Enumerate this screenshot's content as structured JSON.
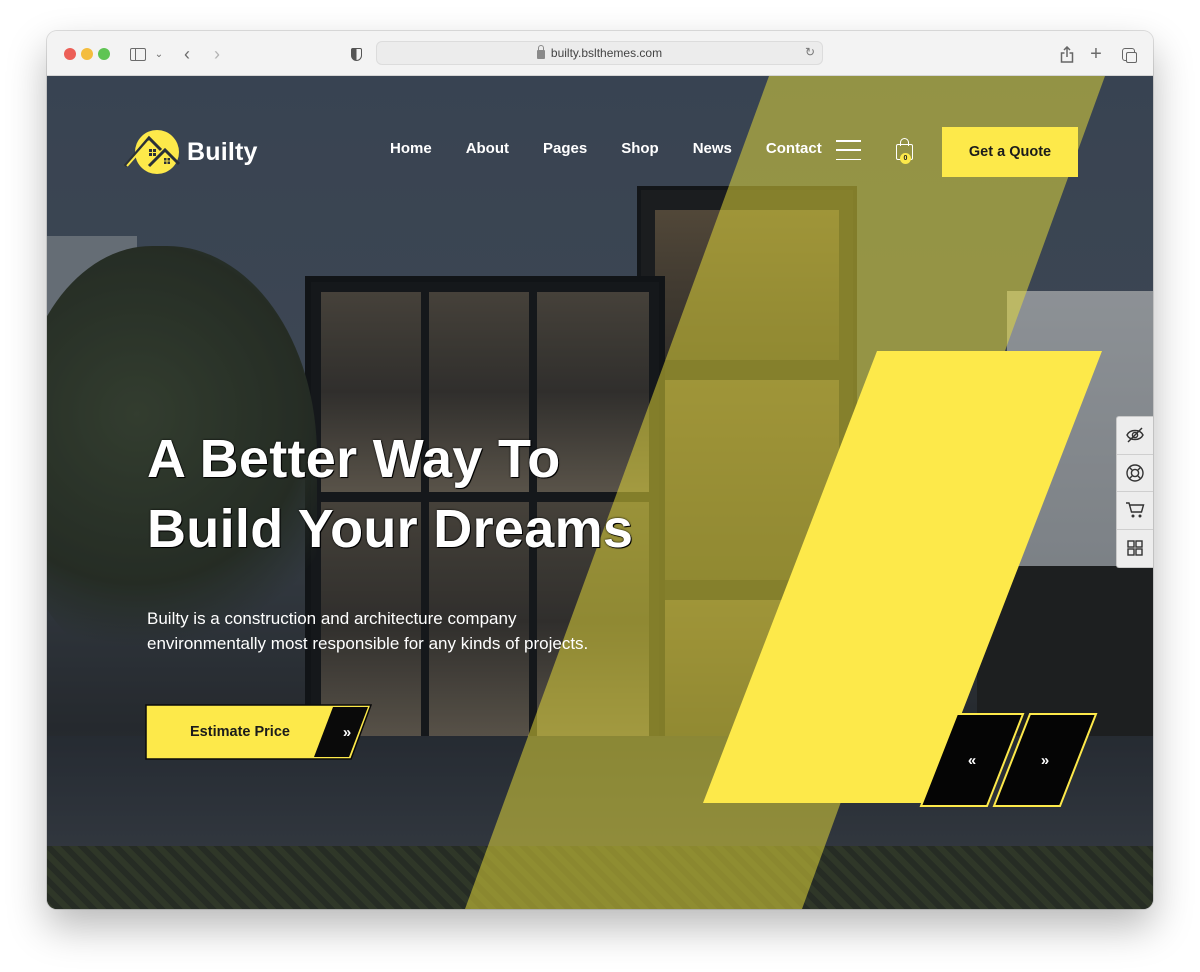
{
  "browser": {
    "url": "builty.bslthemes.com",
    "icons": [
      "sidebar-toggle-icon",
      "chevron-down-icon",
      "back-icon",
      "forward-icon",
      "privacy-shield-icon",
      "lock-icon",
      "reload-icon",
      "share-icon",
      "new-tab-icon",
      "tab-overview-icon"
    ]
  },
  "header": {
    "brand": "Builty",
    "nav": [
      {
        "label": "Home"
      },
      {
        "label": "About"
      },
      {
        "label": "Pages"
      },
      {
        "label": "Shop"
      },
      {
        "label": "News"
      },
      {
        "label": "Contact"
      }
    ],
    "cart_count": "0",
    "cta_label": "Get a Quote"
  },
  "hero": {
    "title_line1": "A Better Way To",
    "title_line2": "Build Your Dreams",
    "subtitle_line1": "Builty is a construction and architecture company",
    "subtitle_line2": "environmentally most responsible for any kinds of projects.",
    "button_label": "Estimate Price",
    "button_arrow": "»"
  },
  "slider": {
    "prev_glyph": "«",
    "next_glyph": "»"
  },
  "side_tools": [
    {
      "name": "hide-icon"
    },
    {
      "name": "support-icon"
    },
    {
      "name": "cart-icon"
    },
    {
      "name": "grid-icon"
    }
  ],
  "colors": {
    "accent": "#fde94a",
    "dark": "#0a0a0a",
    "text_on_dark": "#ffffff"
  }
}
